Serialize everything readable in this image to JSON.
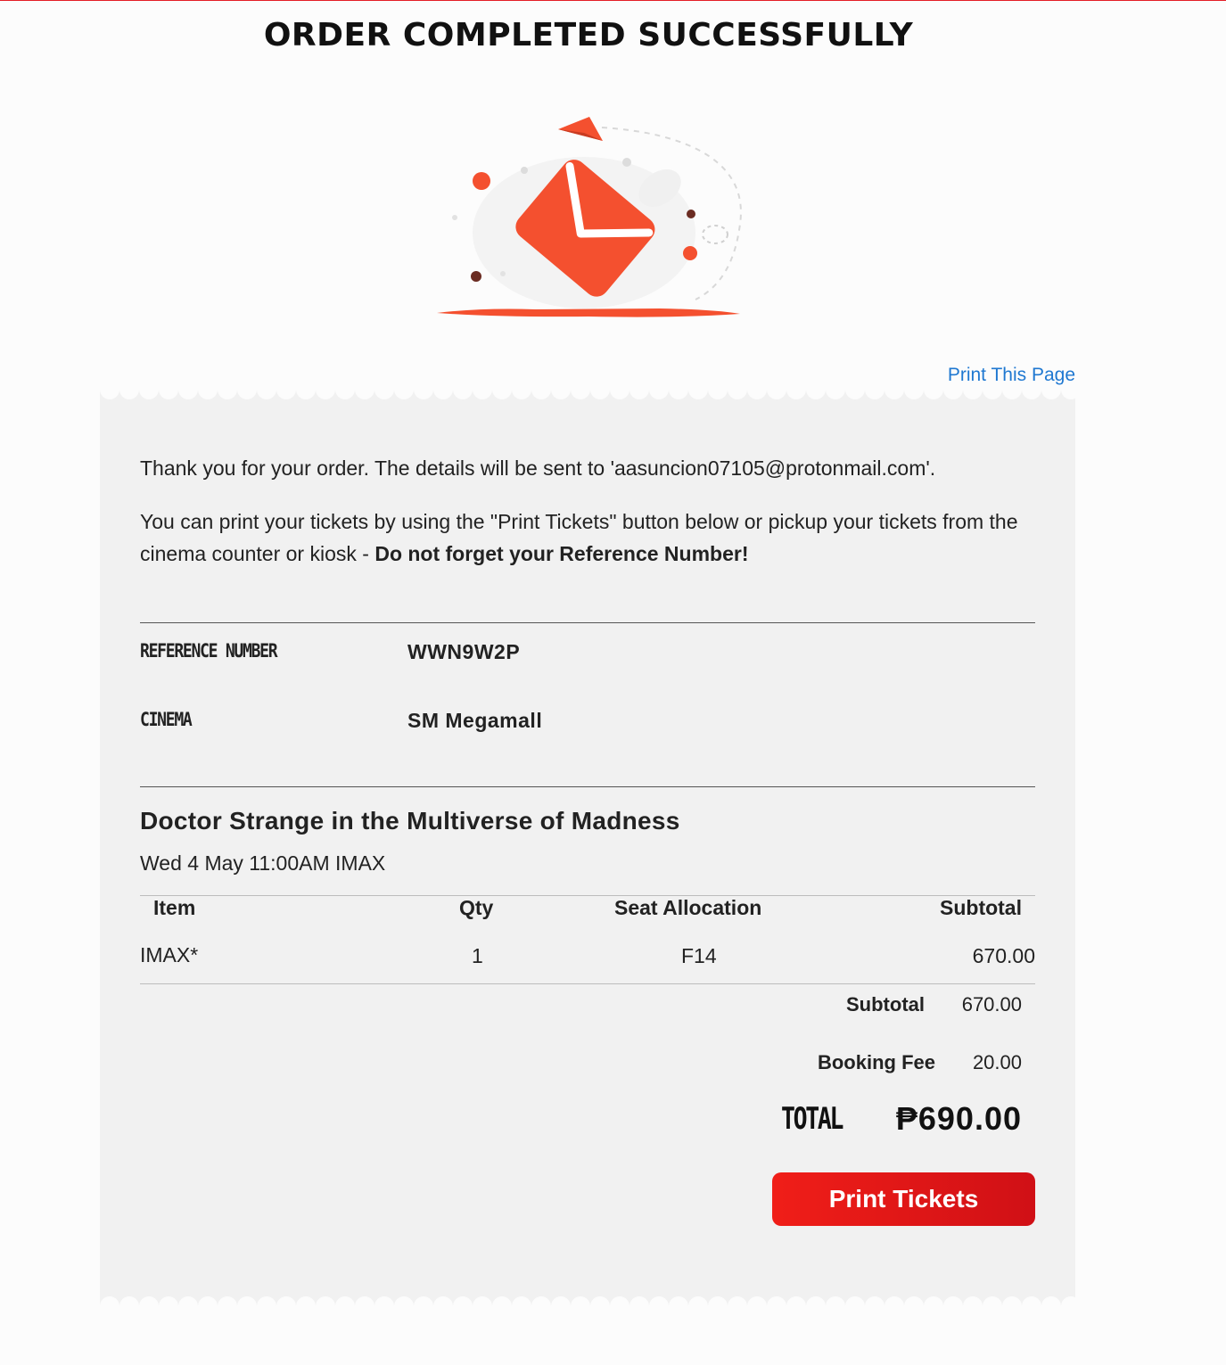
{
  "page": {
    "title": "ORDER COMPLETED SUCCESSFULLY",
    "print_page_link": "Print This Page"
  },
  "hero": {
    "icon": "envelope-sent-illustration",
    "accent": "#f4502f"
  },
  "intro": {
    "line1": "Thank you for your order. The details will be sent to 'aasuncion07105@protonmail.com'.",
    "line2_text": "You can print your tickets by using the \"Print Tickets\" button below or pickup your tickets from the cinema counter or kiosk - ",
    "line2_bold": "Do not forget your Reference Number!"
  },
  "details": {
    "reference_label": "REFERENCE NUMBER",
    "reference_value": "WWN9W2P",
    "cinema_label": "CINEMA",
    "cinema_value": "SM Megamall"
  },
  "movie": {
    "title": "Doctor Strange in the Multiverse of Madness",
    "showtime": "Wed 4 May 11:00AM  IMAX"
  },
  "table": {
    "headers": {
      "item": "Item",
      "qty": "Qty",
      "seat": "Seat Allocation",
      "subtotal": "Subtotal"
    },
    "rows": [
      {
        "item": "IMAX*",
        "qty": "1",
        "seat": "F14",
        "subtotal": "670.00"
      }
    ]
  },
  "summary": {
    "subtotal_label": "Subtotal",
    "subtotal_value": "670.00",
    "booking_fee_label": "Booking Fee",
    "booking_fee_value": "20.00",
    "total_label": "TOTAL",
    "total_value": "₱690.00"
  },
  "actions": {
    "print_tickets": "Print Tickets"
  },
  "colors": {
    "brand_red": "#e41e26",
    "link_blue": "#1f78d1",
    "receipt_bg": "#f1f1f1"
  }
}
